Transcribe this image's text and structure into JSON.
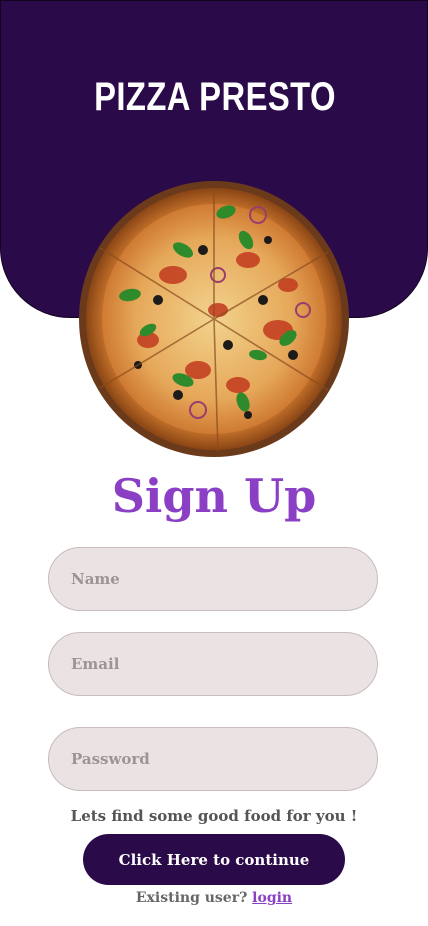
{
  "header": {
    "app_title": "PIZZA PRESTO",
    "background_color": "#2b0a4a"
  },
  "hero": {
    "image_icon": "pizza-image"
  },
  "form": {
    "title": "Sign Up",
    "title_color": "#8a3fc4",
    "name_placeholder": "Name",
    "email_placeholder": "Email",
    "password_placeholder": "Password",
    "tagline": "Lets find some good food for you !",
    "continue_label": "Click Here to continue",
    "existing_user_text": "Existing user? ",
    "login_label": "login"
  }
}
